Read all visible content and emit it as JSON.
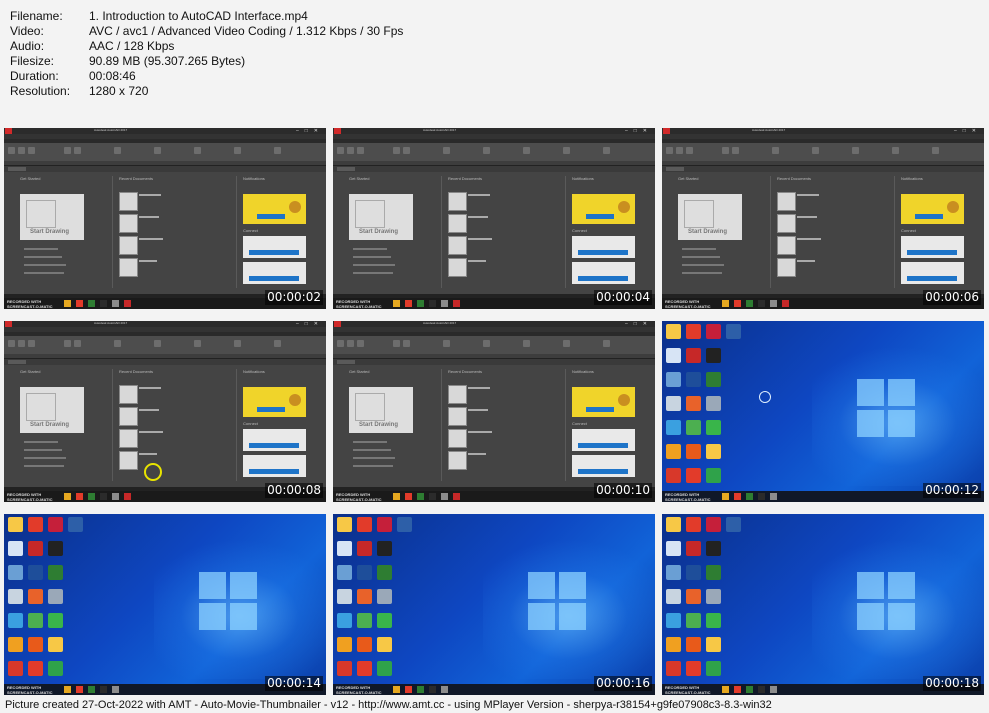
{
  "info": [
    {
      "label": "Filename:",
      "value": "1. Introduction to AutoCAD Interface.mp4"
    },
    {
      "label": "Video:",
      "value": "AVC / avc1 / Advanced Video Coding / 1.312 Kbps / 30 Fps"
    },
    {
      "label": "Audio:",
      "value": "AAC / 128 Kbps"
    },
    {
      "label": "Filesize:",
      "value": "90.89 MB (95.307.265 Bytes)"
    },
    {
      "label": "Duration:",
      "value": "00:08:46"
    },
    {
      "label": "Resolution:",
      "value": "1280 x 720"
    }
  ],
  "thumbnails": [
    {
      "time": "00:00:02",
      "scene": "autocad-start"
    },
    {
      "time": "00:00:04",
      "scene": "autocad-start"
    },
    {
      "time": "00:00:06",
      "scene": "autocad-start"
    },
    {
      "time": "00:00:08",
      "scene": "autocad-start"
    },
    {
      "time": "00:00:10",
      "scene": "autocad-start"
    },
    {
      "time": "00:00:12",
      "scene": "windows-desktop"
    },
    {
      "time": "00:00:14",
      "scene": "windows-desktop"
    },
    {
      "time": "00:00:16",
      "scene": "windows-desktop"
    },
    {
      "time": "00:00:18",
      "scene": "windows-desktop"
    }
  ],
  "autocad_screen": {
    "window_title": "Autodesk AutoCAD 2017",
    "col_get_started": "Get Started",
    "col_recent": "Recent Documents",
    "col_notifications": "Notifications",
    "start_drawing": "Start Drawing",
    "connect": "Connect",
    "recording_badge": "RECORDED WITH",
    "recorder_name": "SCREENCAST-O-MATIC",
    "accent_color": "#1e74c8",
    "notification_color": "#f0d42a"
  },
  "footer": "Picture created 27-Oct-2022 with AMT - Auto-Movie-Thumbnailer - v12 - http://www.amt.cc - using MPlayer Version - sherpya-r38154+g9fe07908c3-8.3-win32"
}
